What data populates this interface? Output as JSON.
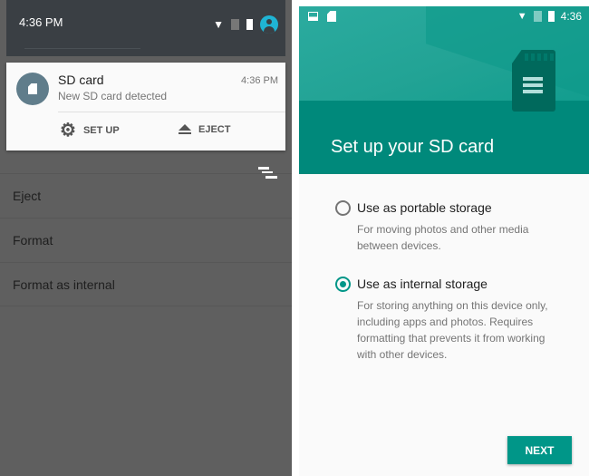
{
  "left_screen": {
    "status_bar": {
      "time": "4:36 PM",
      "icons": [
        "wifi-icon",
        "no-sim-icon",
        "battery-icon",
        "account-icon"
      ]
    },
    "notification": {
      "icon": "sd-card-icon",
      "title": "SD card",
      "text": "New SD card detected",
      "time": "4:36 PM",
      "actions": [
        {
          "label": "SET UP",
          "icon": "gear-icon"
        },
        {
          "label": "EJECT",
          "icon": "eject-icon"
        }
      ]
    },
    "menu_items": [
      "Eject",
      "Format",
      "Format as internal"
    ]
  },
  "right_screen": {
    "status_bar": {
      "time": "4:36",
      "icons": [
        "image-icon",
        "sd-card-icon",
        "wifi-icon",
        "no-sim-icon",
        "battery-icon"
      ]
    },
    "title": "Set up your SD card",
    "options": [
      {
        "label": "Use as portable storage",
        "description": "For moving photos and other media between devices.",
        "selected": false
      },
      {
        "label": "Use as internal storage",
        "description": "For storing anything on this device only, including apps and photos. Requires formatting that prevents it from working with other devices.",
        "selected": true
      }
    ],
    "next_label": "NEXT"
  },
  "colors": {
    "accent": "#009688",
    "header": "#00897b",
    "notification_icon": "#607d8b",
    "avatar": "#1fb4d4"
  }
}
